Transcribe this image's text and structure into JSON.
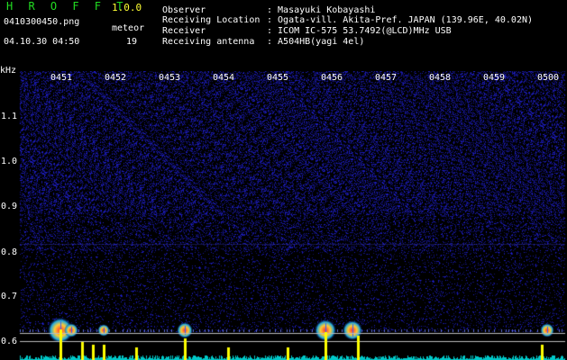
{
  "app": {
    "title": "H R O F F T",
    "version": "1.0.0",
    "file_name": "0410300450.png",
    "date_time": "04.10.30 04:50",
    "meteor_label": "meteor",
    "meteor_count": "19"
  },
  "info": [
    {
      "label": "Observer",
      "value": ": Masayuki Kobayashi"
    },
    {
      "label": "Receiving Location",
      "value": ": Ogata-vill. Akita-Pref. JAPAN (139.96E, 40.02N)"
    },
    {
      "label": "Receiver",
      "value": ": ICOM IC-575 53.7492(@LCD)MHz USB"
    },
    {
      "label": "Receiving antenna",
      "value": ": A504HB(yagi 4el)"
    }
  ],
  "axis": {
    "unit_label": "kHz",
    "time_ticks": [
      "0451",
      "0452",
      "0453",
      "0454",
      "0455",
      "0456",
      "0457",
      "0458",
      "0459",
      "0500"
    ],
    "freq_ticks": [
      "1.1",
      "1.0",
      "0.9",
      "0.8",
      "0.7",
      "0.6"
    ]
  },
  "colors": {
    "title": "#22dd22",
    "version": "#ffff33",
    "noise": "#1a1aa0",
    "echo": "#ff3030",
    "peak": "#ffff00",
    "baseline": "#00c8c8"
  },
  "chart_data": {
    "type": "heatmap",
    "x_range": [
      "04:50",
      "05:00"
    ],
    "y_range_khz": [
      0.58,
      1.24
    ],
    "meteor_echoes": [
      {
        "time": "04:50.9",
        "freq_khz": 0.68,
        "strength": 1.0
      },
      {
        "time": "04:51.1",
        "freq_khz": 0.68,
        "strength": 0.4
      },
      {
        "time": "04:51.7",
        "freq_khz": 0.68,
        "strength": 0.3
      },
      {
        "time": "04:53.2",
        "freq_khz": 0.68,
        "strength": 0.5
      },
      {
        "time": "04:55.8",
        "freq_khz": 0.68,
        "strength": 0.8
      },
      {
        "time": "04:56.3",
        "freq_khz": 0.68,
        "strength": 0.7
      },
      {
        "time": "04:59.9",
        "freq_khz": 0.68,
        "strength": 0.4
      }
    ],
    "power_peaks": [
      {
        "time": "04:50.9",
        "level": 1.0
      },
      {
        "time": "04:51.3",
        "level": 0.6
      },
      {
        "time": "04:51.5",
        "level": 0.5
      },
      {
        "time": "04:51.7",
        "level": 0.5
      },
      {
        "time": "04:52.3",
        "level": 0.4
      },
      {
        "time": "04:53.2",
        "level": 0.7
      },
      {
        "time": "04:54.0",
        "level": 0.4
      },
      {
        "time": "04:55.1",
        "level": 0.4
      },
      {
        "time": "04:55.8",
        "level": 0.9
      },
      {
        "time": "04:56.4",
        "level": 0.8
      },
      {
        "time": "04:59.8",
        "level": 0.5
      }
    ]
  }
}
